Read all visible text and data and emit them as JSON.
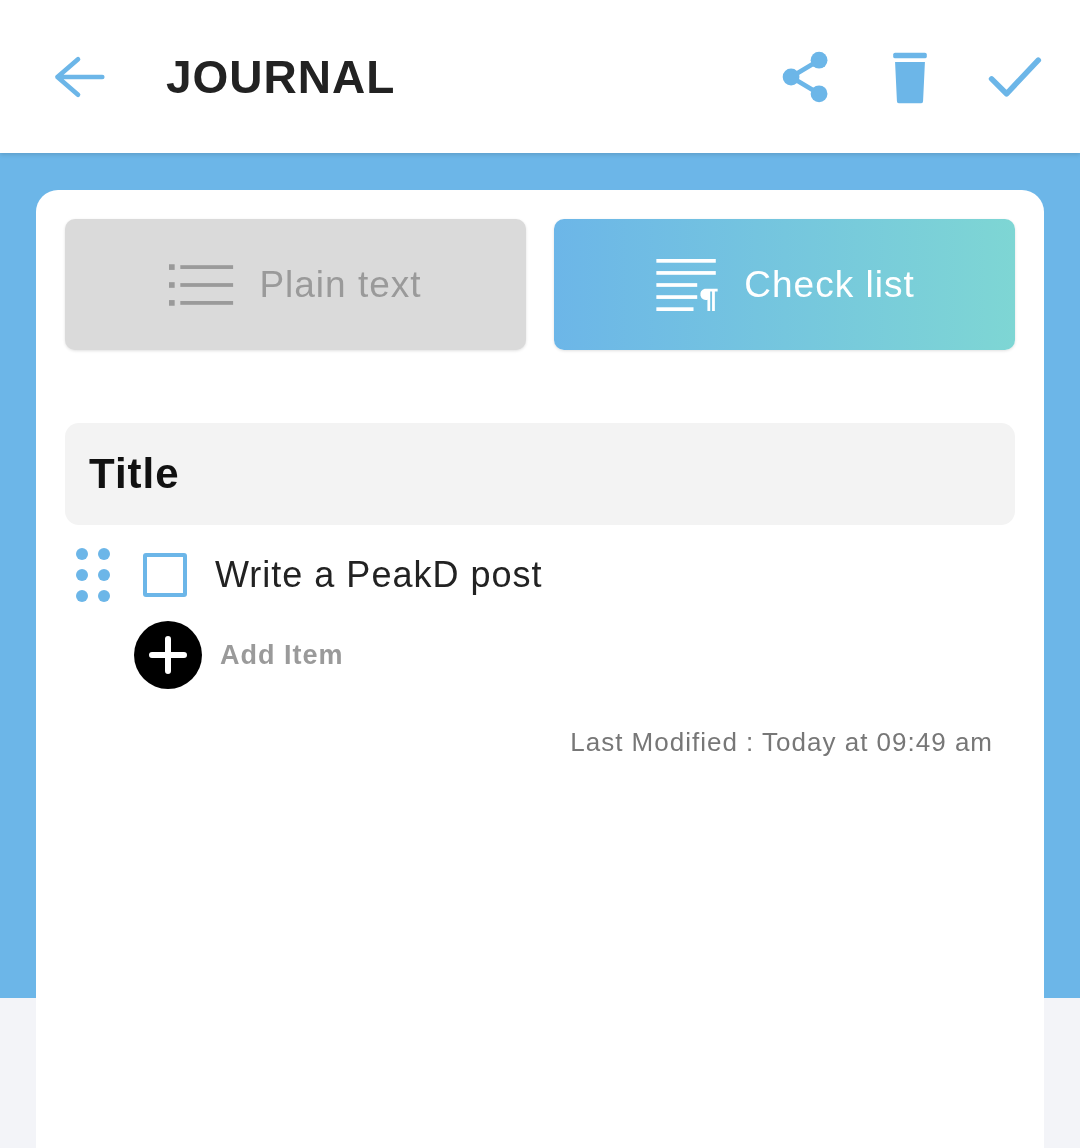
{
  "header": {
    "title": "JOURNAL"
  },
  "mode_tabs": [
    {
      "label": "Plain text",
      "selected": false,
      "kind": "plain"
    },
    {
      "label": "Check list",
      "selected": true,
      "kind": "checklist"
    }
  ],
  "note": {
    "title": "Title",
    "items": [
      {
        "text": "Write a PeakD post",
        "checked": false
      }
    ],
    "add_item_label": "Add Item",
    "last_modified": "Last Modified : Today at 09:49 am"
  }
}
